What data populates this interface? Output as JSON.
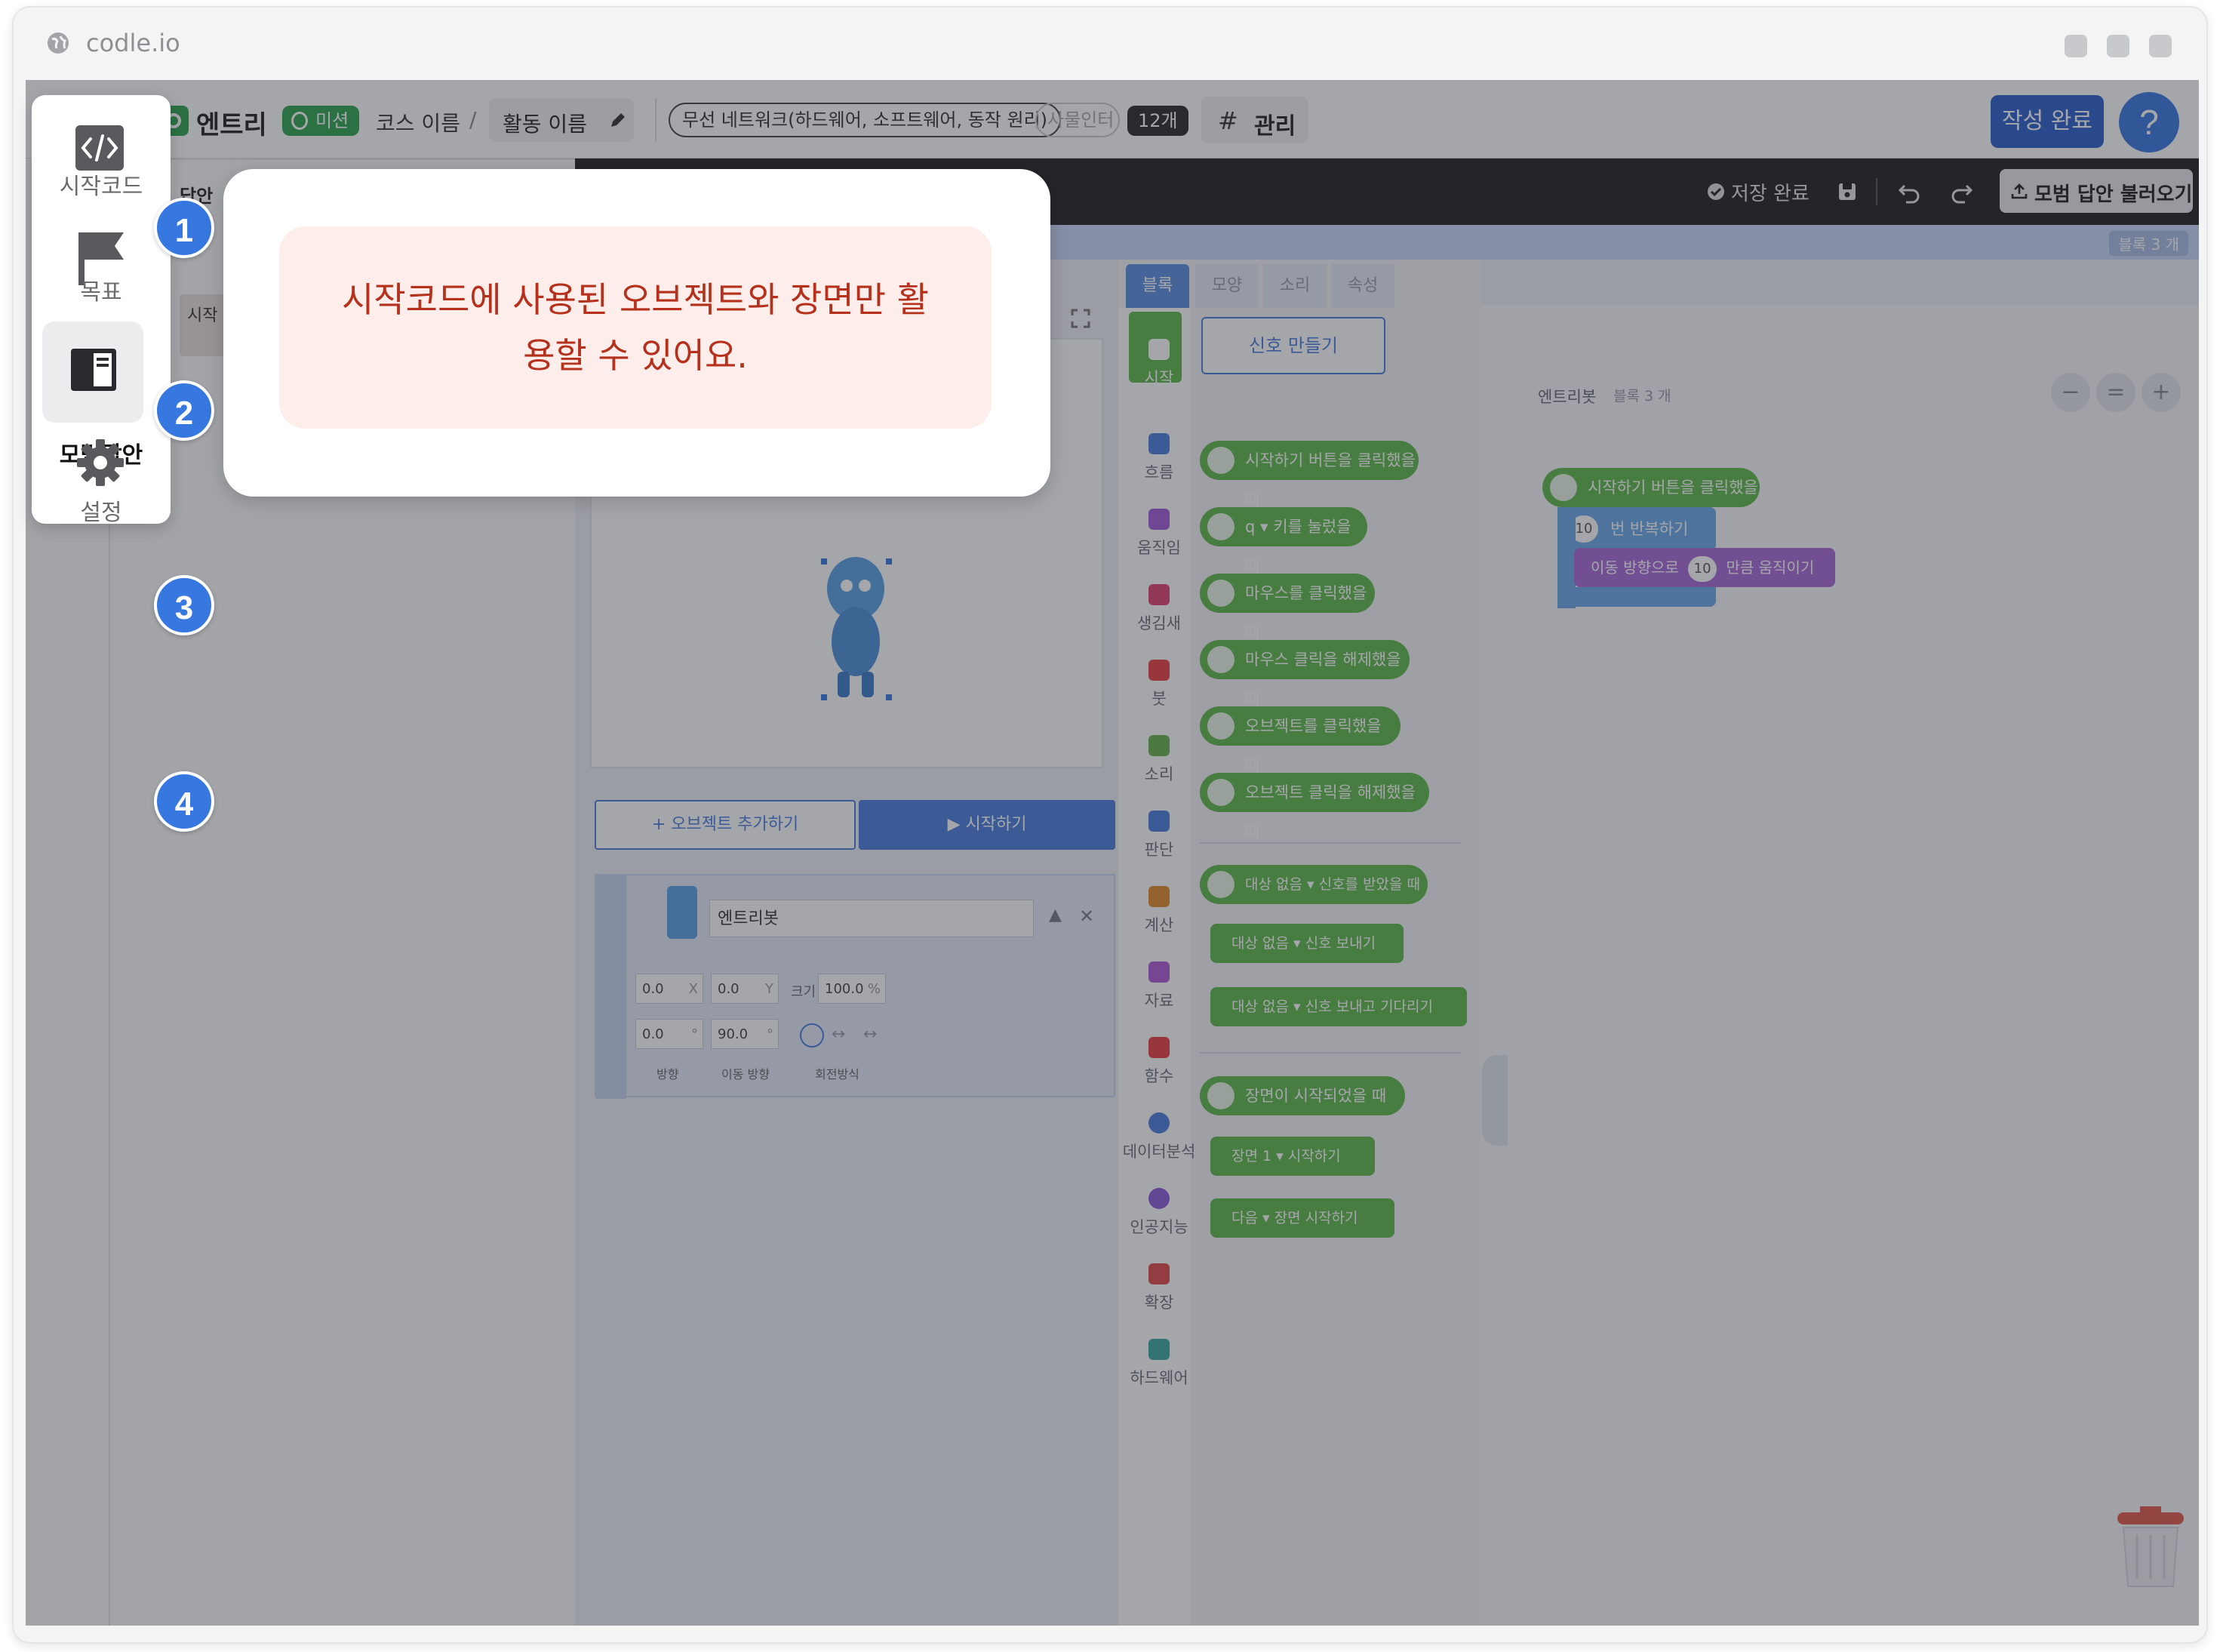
{
  "browser": {
    "url": "codle.io"
  },
  "topbar": {
    "app_name": "엔트리",
    "mission_badge": "미션",
    "course_name": "코스 이름",
    "separator": "/",
    "activity_name": "활동 이름",
    "tag_main": "무선 네트워크(하드웨어, 소프트웨어, 동작 원리)",
    "tag_secondary": "사물인터",
    "tag_count": "12개",
    "manage_label": "관리",
    "complete_button": "작성 완료",
    "help_button": "?"
  },
  "editor_toolbar": {
    "save_status": "저장 완료",
    "load_button": "모범 답안 불러오기",
    "left_partial": "답안",
    "left_partial_2": "시작"
  },
  "workspace_header": {
    "block_count": "블록 3 개"
  },
  "palette_tabs": [
    "블록",
    "모양",
    "소리",
    "속성"
  ],
  "categories": [
    "시작",
    "흐름",
    "움직임",
    "생김새",
    "붓",
    "소리",
    "판단",
    "계산",
    "자료",
    "함수",
    "데이터분석",
    "인공지능",
    "확장",
    "하드웨어"
  ],
  "palette_blocks": {
    "signal_button": "신호 만들기",
    "b1": "시작하기 버튼을 클릭했을 때",
    "b2_key": "q",
    "b2": "키를 눌렀을 때",
    "b3": "마우스를 클릭했을 때",
    "b4": "마우스 클릭을 해제했을 때",
    "b5": "오브젝트를 클릭했을 때",
    "b6": "오브젝트 클릭을 해제했을 때",
    "b7_target": "대상 없음",
    "b7": "신호를 받았을 때",
    "b8_target": "대상 없음",
    "b8": "신호 보내기",
    "b9_target": "대상 없음",
    "b9": "신호 보내고 기다리기",
    "b10": "장면이 시작되었을 때",
    "b11_scene": "장면 1",
    "b11": "시작하기",
    "b12_scene": "다음",
    "b12": "장면 시작하기"
  },
  "script": {
    "object_name": "엔트리봇",
    "block_count": "블록 3 개",
    "s1": "시작하기 버튼을 클릭했을 때",
    "s2_num": "10",
    "s2": "번 반복하기",
    "s3_pre": "이동 방향으로",
    "s3_num": "10",
    "s3": "만큼 움직이기"
  },
  "stage": {
    "add_object": "+ 오브젝트 추가하기",
    "start_button": "▶ 시작하기",
    "object_name": "엔트리봇",
    "x_val": "0.0",
    "x_label": "X",
    "y_val": "0.0",
    "y_label": "Y",
    "size_label": "크기",
    "size_val": "100.0",
    "size_unit": "%",
    "dir_val": "0.0",
    "dir_unit": "°",
    "move_dir_val": "90.0",
    "move_dir_unit": "°",
    "dir_label": "방향",
    "move_dir_label": "이동 방향",
    "rotate_label": "회전방식"
  },
  "side_menu": {
    "items": [
      {
        "number": "1",
        "label": "시작코드",
        "icon": "code-icon"
      },
      {
        "number": "2",
        "label": "목표",
        "icon": "flag-icon"
      },
      {
        "number": "3",
        "label": "모범답안",
        "icon": "answer-book-icon"
      },
      {
        "number": "4",
        "label": "설정",
        "icon": "gear-icon"
      }
    ]
  },
  "tooltip": {
    "message": "시작코드에 사용된 오브젝트와 장면만 활용할 수 있어요."
  },
  "colors": {
    "accent_blue": "#3777e0",
    "dark_blue_button": "#1e4fa8",
    "block_green": "#5fb94c",
    "tooltip_bg": "#fdeeec",
    "tooltip_text": "#b5311c"
  }
}
